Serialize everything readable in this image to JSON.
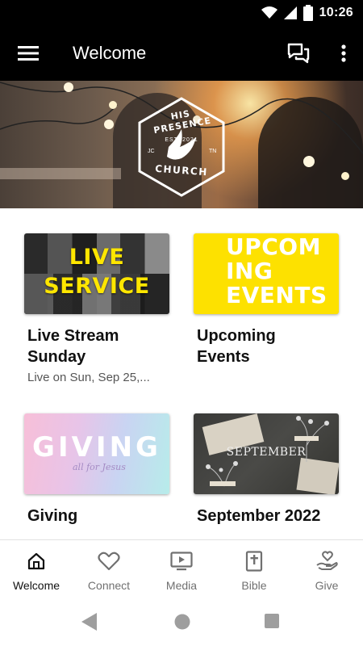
{
  "status_bar": {
    "time": "10:26",
    "icons": [
      "wifi-icon",
      "signal-icon",
      "battery-icon"
    ]
  },
  "app_bar": {
    "title": "Welcome",
    "icons": [
      "menu-icon",
      "chat-icon",
      "more-vert-icon"
    ]
  },
  "hero": {
    "logo_top_text": "HIS PRESENCE",
    "logo_bottom_text": "CHURCH",
    "logo_est": "EST. 2021",
    "logo_left": "JC",
    "logo_right": "TN"
  },
  "cards": [
    {
      "thumb_text": "LIVE\nSERVICE",
      "title": "Live Stream Sunday",
      "subtitle": "Live on Sun, Sep 25,..."
    },
    {
      "thumb_text": "UPCOM\nING\nEVENTS",
      "title": "Upcoming Events",
      "subtitle": ""
    },
    {
      "thumb_text": "GIVING",
      "thumb_script": "all for Jesus",
      "title": "Giving",
      "subtitle": ""
    },
    {
      "thumb_text": "SEPTEMBER",
      "title": "September 2022",
      "subtitle": ""
    }
  ],
  "bottom_nav": [
    {
      "label": "Welcome",
      "icon": "home-icon",
      "active": true
    },
    {
      "label": "Connect",
      "icon": "heart-icon",
      "active": false
    },
    {
      "label": "Media",
      "icon": "play-screen-icon",
      "active": false
    },
    {
      "label": "Bible",
      "icon": "bible-icon",
      "active": false
    },
    {
      "label": "Give",
      "icon": "give-hand-heart-icon",
      "active": false
    }
  ],
  "colors": {
    "app_bar": "#000000",
    "events_yellow": "#fde100",
    "live_text_yellow": "#ffe600",
    "nav_active": "#111111",
    "nav_inactive": "#707070"
  }
}
